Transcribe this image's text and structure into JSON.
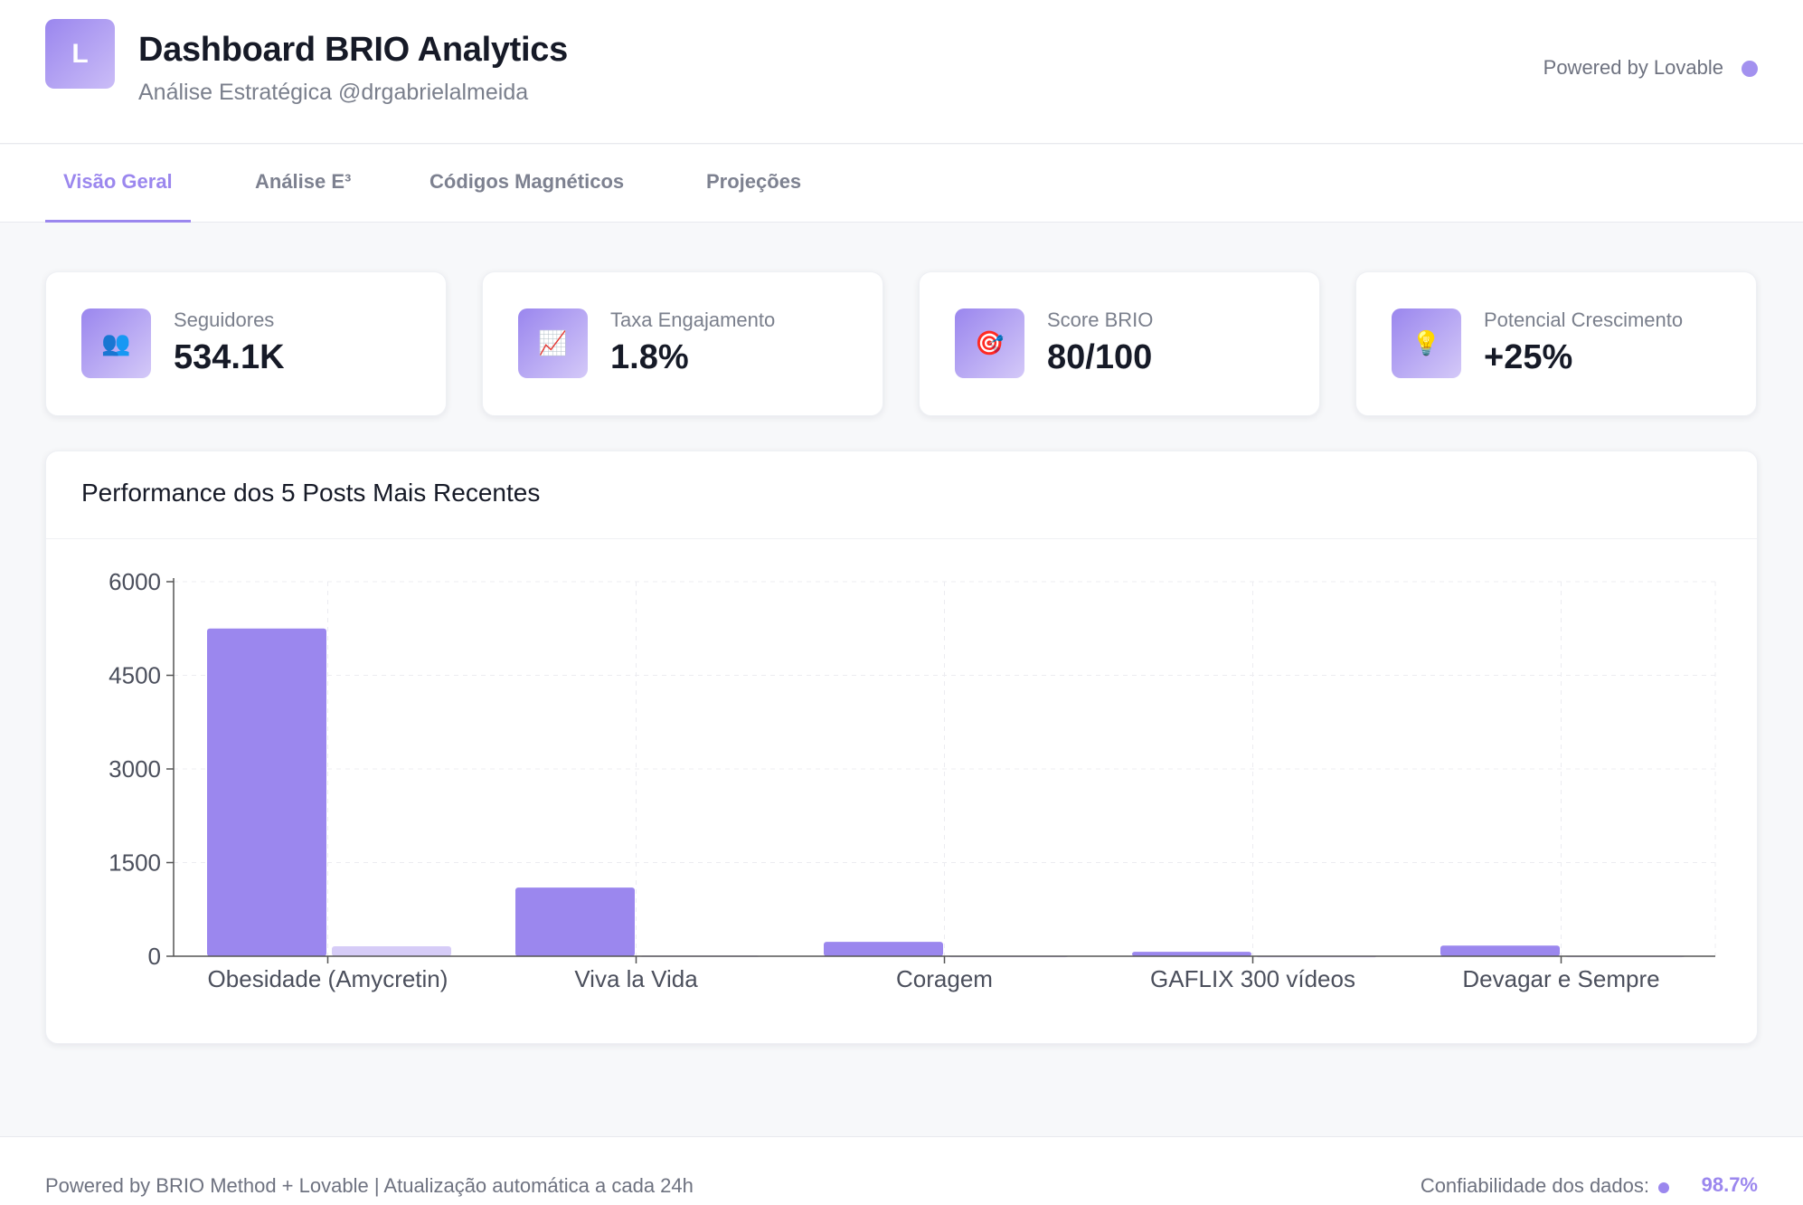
{
  "header": {
    "logo_letter": "L",
    "title": "Dashboard BRIO Analytics",
    "subtitle": "Análise Estratégica @drgabrielalmeida",
    "powered": "Powered by Lovable"
  },
  "tabs": [
    {
      "label": "Visão Geral",
      "active": true
    },
    {
      "label": "Análise E³",
      "active": false
    },
    {
      "label": "Códigos Magnéticos",
      "active": false
    },
    {
      "label": "Projeções",
      "active": false
    }
  ],
  "stats": [
    {
      "icon": "people-icon",
      "glyph": "👥",
      "label": "Seguidores",
      "value": "534.1K"
    },
    {
      "icon": "chart-increasing-icon",
      "glyph": "📈",
      "label": "Taxa Engajamento",
      "value": "1.8%"
    },
    {
      "icon": "target-icon",
      "glyph": "🎯",
      "label": "Score BRIO",
      "value": "80/100"
    },
    {
      "icon": "lightbulb-icon",
      "glyph": "💡",
      "label": "Potencial Crescimento",
      "value": "+25%"
    }
  ],
  "chart": {
    "title": "Performance dos 5 Posts Mais Recentes"
  },
  "chart_data": {
    "type": "bar",
    "categories": [
      "Obesidade (Amycretin)",
      "Viva la Vida",
      "Coragem",
      "GAFLIX 300 vídeos",
      "Devagar e Sempre"
    ],
    "series": [
      {
        "values": [
          5250,
          1100,
          230,
          70,
          170
        ],
        "color": "#9b87ee"
      },
      {
        "values": [
          160,
          10,
          5,
          3,
          5
        ],
        "color": "#d6ccf7"
      }
    ],
    "yticks": [
      0,
      1500,
      3000,
      4500,
      6000
    ],
    "ylim": [
      0,
      6000
    ],
    "grid": true,
    "xlabel": "",
    "ylabel": ""
  },
  "footer": {
    "left": "Powered by BRIO Method + Lovable | Atualização automática a cada 24h",
    "right_label": "Confiabilidade dos dados:",
    "right_value": "98.7%"
  },
  "colors": {
    "accent": "#9b87ee",
    "accent_light": "#d6ccf7"
  }
}
